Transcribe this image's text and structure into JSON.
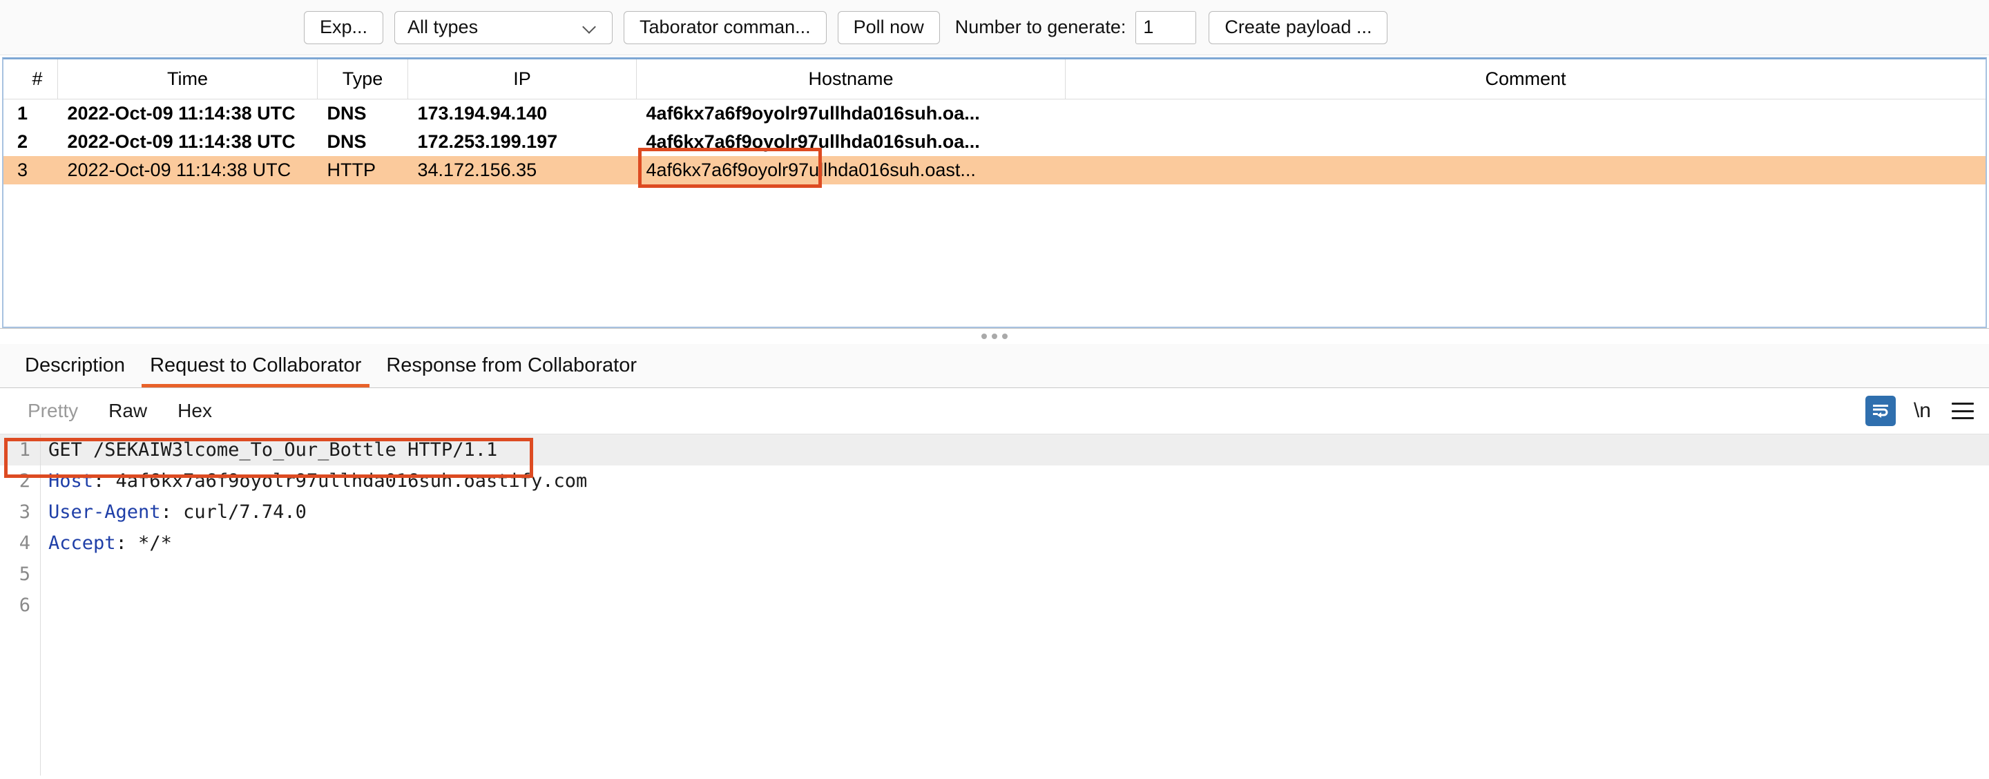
{
  "toolbar": {
    "export_button": "Exp...",
    "type_filter": {
      "value": "All types",
      "icon": "chevron-down-icon"
    },
    "collaborator_button": "Taborator comman...",
    "poll_button": "Poll now",
    "number_label": "Number to generate:",
    "number_value": "1",
    "create_payload_button": "Create payload ..."
  },
  "events_table": {
    "columns": [
      "#",
      "Time",
      "Type",
      "IP",
      "Hostname",
      "Comment"
    ],
    "rows": [
      {
        "num": "1",
        "time": "2022-Oct-09 11:14:38 UTC",
        "type": "DNS",
        "ip": "173.194.94.140",
        "hostname": "4af6kx7a6f9oyolr97ullhda016suh.oa...",
        "comment": "",
        "state": "unread",
        "selected": false
      },
      {
        "num": "2",
        "time": "2022-Oct-09 11:14:38 UTC",
        "type": "DNS",
        "ip": "172.253.199.197",
        "hostname": "4af6kx7a6f9oyolr97ullhda016suh.oa...",
        "comment": "",
        "state": "unread",
        "selected": false
      },
      {
        "num": "3",
        "time": "2022-Oct-09 11:14:38 UTC",
        "type": "HTTP",
        "ip": "34.172.156.35",
        "hostname": "4af6kx7a6f9oyolr97ullhda016suh.oast...",
        "comment": "",
        "state": "read",
        "selected": true
      }
    ]
  },
  "detail_tabs": [
    {
      "label": "Description",
      "active": false
    },
    {
      "label": "Request to Collaborator",
      "active": true
    },
    {
      "label": "Response from Collaborator",
      "active": false
    }
  ],
  "view_modes": [
    {
      "label": "Pretty",
      "enabled": false
    },
    {
      "label": "Raw",
      "enabled": true
    },
    {
      "label": "Hex",
      "enabled": true
    }
  ],
  "view_icons": {
    "wrap": "word-wrap-icon",
    "newline": "\\n",
    "menu": "hamburger-menu-icon"
  },
  "request": {
    "lines": [
      {
        "n": "1",
        "key": "",
        "text": "GET /SEKAIW3lcome_To_Our_Bottle HTTP/1.1",
        "highlight": true
      },
      {
        "n": "2",
        "key": "Host",
        "text": ": 4af6kx7a6f9oyolr97ullhda016suh.oastify.com",
        "highlight": false
      },
      {
        "n": "3",
        "key": "User-Agent",
        "text": ": curl/7.74.0",
        "highlight": false
      },
      {
        "n": "4",
        "key": "Accept",
        "text": ": */*",
        "highlight": false
      },
      {
        "n": "5",
        "key": "",
        "text": "",
        "highlight": false
      },
      {
        "n": "6",
        "key": "",
        "text": "",
        "highlight": false
      }
    ]
  },
  "colors": {
    "annotation": "#dd4b22",
    "selection": "#fbca9c",
    "tab_accent": "#e8622a",
    "header_key": "#1f3fa8",
    "wrap_active": "#2f6fae"
  }
}
